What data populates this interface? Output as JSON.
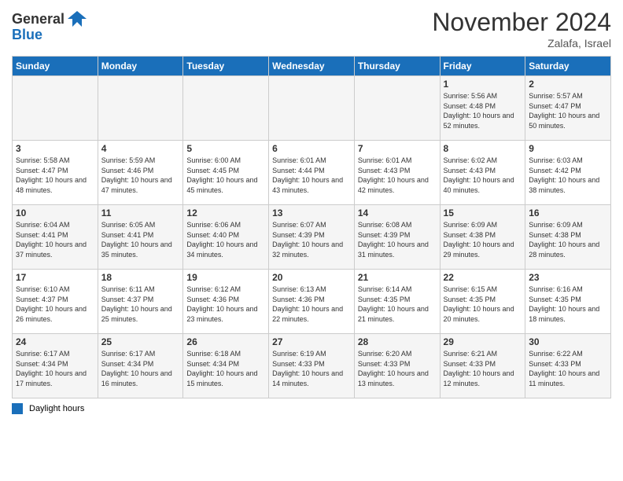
{
  "header": {
    "logo_line1": "General",
    "logo_line2": "Blue",
    "month": "November 2024",
    "location": "Zalafa, Israel"
  },
  "days_of_week": [
    "Sunday",
    "Monday",
    "Tuesday",
    "Wednesday",
    "Thursday",
    "Friday",
    "Saturday"
  ],
  "weeks": [
    [
      {
        "num": "",
        "info": ""
      },
      {
        "num": "",
        "info": ""
      },
      {
        "num": "",
        "info": ""
      },
      {
        "num": "",
        "info": ""
      },
      {
        "num": "",
        "info": ""
      },
      {
        "num": "1",
        "info": "Sunrise: 5:56 AM\nSunset: 4:48 PM\nDaylight: 10 hours and 52 minutes."
      },
      {
        "num": "2",
        "info": "Sunrise: 5:57 AM\nSunset: 4:47 PM\nDaylight: 10 hours and 50 minutes."
      }
    ],
    [
      {
        "num": "3",
        "info": "Sunrise: 5:58 AM\nSunset: 4:47 PM\nDaylight: 10 hours and 48 minutes."
      },
      {
        "num": "4",
        "info": "Sunrise: 5:59 AM\nSunset: 4:46 PM\nDaylight: 10 hours and 47 minutes."
      },
      {
        "num": "5",
        "info": "Sunrise: 6:00 AM\nSunset: 4:45 PM\nDaylight: 10 hours and 45 minutes."
      },
      {
        "num": "6",
        "info": "Sunrise: 6:01 AM\nSunset: 4:44 PM\nDaylight: 10 hours and 43 minutes."
      },
      {
        "num": "7",
        "info": "Sunrise: 6:01 AM\nSunset: 4:43 PM\nDaylight: 10 hours and 42 minutes."
      },
      {
        "num": "8",
        "info": "Sunrise: 6:02 AM\nSunset: 4:43 PM\nDaylight: 10 hours and 40 minutes."
      },
      {
        "num": "9",
        "info": "Sunrise: 6:03 AM\nSunset: 4:42 PM\nDaylight: 10 hours and 38 minutes."
      }
    ],
    [
      {
        "num": "10",
        "info": "Sunrise: 6:04 AM\nSunset: 4:41 PM\nDaylight: 10 hours and 37 minutes."
      },
      {
        "num": "11",
        "info": "Sunrise: 6:05 AM\nSunset: 4:41 PM\nDaylight: 10 hours and 35 minutes."
      },
      {
        "num": "12",
        "info": "Sunrise: 6:06 AM\nSunset: 4:40 PM\nDaylight: 10 hours and 34 minutes."
      },
      {
        "num": "13",
        "info": "Sunrise: 6:07 AM\nSunset: 4:39 PM\nDaylight: 10 hours and 32 minutes."
      },
      {
        "num": "14",
        "info": "Sunrise: 6:08 AM\nSunset: 4:39 PM\nDaylight: 10 hours and 31 minutes."
      },
      {
        "num": "15",
        "info": "Sunrise: 6:09 AM\nSunset: 4:38 PM\nDaylight: 10 hours and 29 minutes."
      },
      {
        "num": "16",
        "info": "Sunrise: 6:09 AM\nSunset: 4:38 PM\nDaylight: 10 hours and 28 minutes."
      }
    ],
    [
      {
        "num": "17",
        "info": "Sunrise: 6:10 AM\nSunset: 4:37 PM\nDaylight: 10 hours and 26 minutes."
      },
      {
        "num": "18",
        "info": "Sunrise: 6:11 AM\nSunset: 4:37 PM\nDaylight: 10 hours and 25 minutes."
      },
      {
        "num": "19",
        "info": "Sunrise: 6:12 AM\nSunset: 4:36 PM\nDaylight: 10 hours and 23 minutes."
      },
      {
        "num": "20",
        "info": "Sunrise: 6:13 AM\nSunset: 4:36 PM\nDaylight: 10 hours and 22 minutes."
      },
      {
        "num": "21",
        "info": "Sunrise: 6:14 AM\nSunset: 4:35 PM\nDaylight: 10 hours and 21 minutes."
      },
      {
        "num": "22",
        "info": "Sunrise: 6:15 AM\nSunset: 4:35 PM\nDaylight: 10 hours and 20 minutes."
      },
      {
        "num": "23",
        "info": "Sunrise: 6:16 AM\nSunset: 4:35 PM\nDaylight: 10 hours and 18 minutes."
      }
    ],
    [
      {
        "num": "24",
        "info": "Sunrise: 6:17 AM\nSunset: 4:34 PM\nDaylight: 10 hours and 17 minutes."
      },
      {
        "num": "25",
        "info": "Sunrise: 6:17 AM\nSunset: 4:34 PM\nDaylight: 10 hours and 16 minutes."
      },
      {
        "num": "26",
        "info": "Sunrise: 6:18 AM\nSunset: 4:34 PM\nDaylight: 10 hours and 15 minutes."
      },
      {
        "num": "27",
        "info": "Sunrise: 6:19 AM\nSunset: 4:33 PM\nDaylight: 10 hours and 14 minutes."
      },
      {
        "num": "28",
        "info": "Sunrise: 6:20 AM\nSunset: 4:33 PM\nDaylight: 10 hours and 13 minutes."
      },
      {
        "num": "29",
        "info": "Sunrise: 6:21 AM\nSunset: 4:33 PM\nDaylight: 10 hours and 12 minutes."
      },
      {
        "num": "30",
        "info": "Sunrise: 6:22 AM\nSunset: 4:33 PM\nDaylight: 10 hours and 11 minutes."
      }
    ]
  ],
  "legend": {
    "label": "Daylight hours"
  }
}
